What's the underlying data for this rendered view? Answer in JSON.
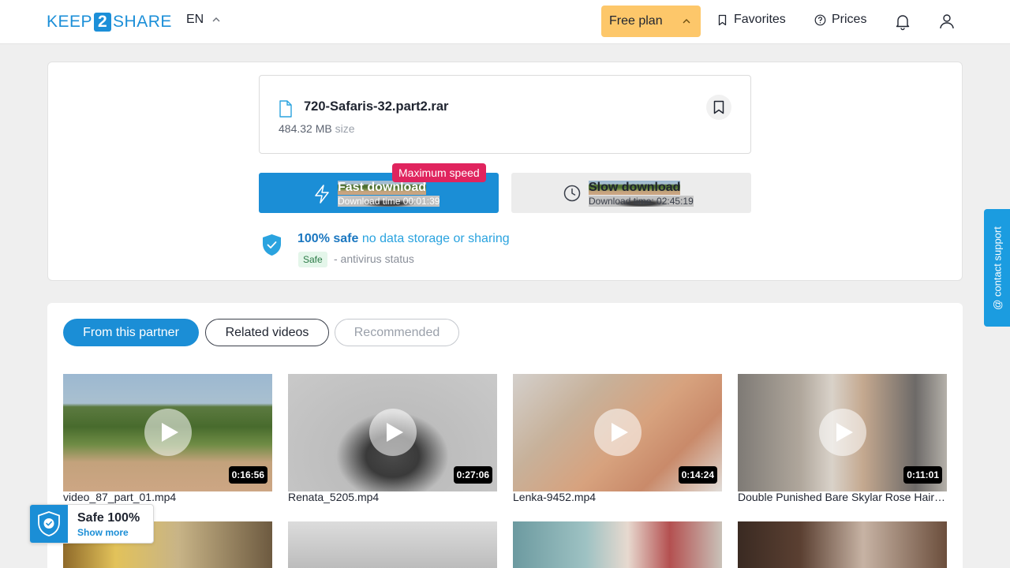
{
  "header": {
    "logo_left": "KEEP",
    "logo_mid": "2",
    "logo_right": "SHARE",
    "language": "EN",
    "plan_label": "Free plan",
    "favorites_label": "Favorites",
    "prices_label": "Prices"
  },
  "file": {
    "name": "720-Safaris-32.part2.rar",
    "size": "484.32 MB",
    "size_label": "size"
  },
  "download": {
    "badge": "Maximum speed",
    "fast_title": "Fast download",
    "fast_time": "Download time 00:01:39",
    "slow_title": "Slow download",
    "slow_time": "Download time: 02:45:19"
  },
  "safety": {
    "bold": "100% safe",
    "rest": "no data storage or sharing",
    "tag": "Safe",
    "status": "- antivirus status"
  },
  "tabs": [
    "From this partner",
    "Related videos",
    "Recommended"
  ],
  "videos": [
    {
      "name": "video_87_part_01.mp4",
      "duration": "0:16:56"
    },
    {
      "name": "Renata_5205.mp4",
      "duration": "0:27:06"
    },
    {
      "name": "Lenka-9452.mp4",
      "duration": "0:14:24"
    },
    {
      "name": "Double Punished Bare Skylar Rose Hair…",
      "duration": "0:11:01"
    }
  ],
  "safe_popup": {
    "title": "Safe 100%",
    "more": "Show more"
  },
  "support_label": "@ contact support",
  "colors": {
    "accent": "#1b8ed6",
    "plan": "#fdc76a",
    "badge": "#e0245e"
  }
}
